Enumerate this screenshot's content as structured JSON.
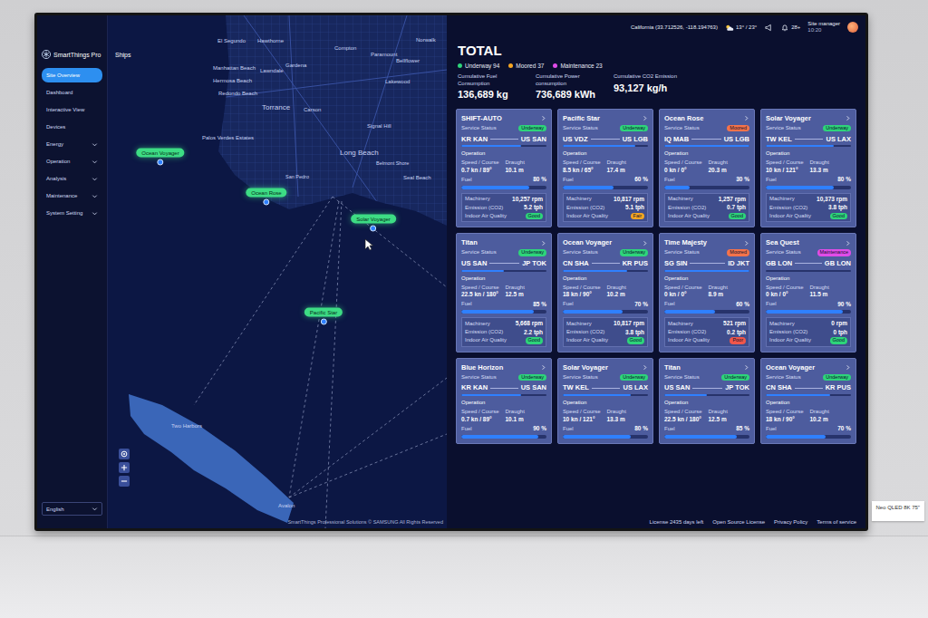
{
  "window": {
    "title": "SmartThings Pro"
  },
  "sidebar": {
    "logo": "SmartThings Pro",
    "items": [
      {
        "label": "Site Overview",
        "selected": true,
        "expandable": false
      },
      {
        "label": "Dashboard",
        "selected": false,
        "expandable": false
      },
      {
        "label": "Interactive View",
        "selected": false,
        "expandable": false
      },
      {
        "label": "Devices",
        "selected": false,
        "expandable": false
      },
      {
        "label": "Energy",
        "selected": false,
        "expandable": true
      },
      {
        "label": "Operation",
        "selected": false,
        "expandable": true
      },
      {
        "label": "Analysis",
        "selected": false,
        "expandable": true
      },
      {
        "label": "Maintenance",
        "selected": false,
        "expandable": true
      },
      {
        "label": "System Setting",
        "selected": false,
        "expandable": true
      }
    ],
    "language": "English"
  },
  "map": {
    "title": "Ships",
    "places": [
      {
        "label": "El Segundo"
      },
      {
        "label": "Hawthorne"
      },
      {
        "label": "Gardena"
      },
      {
        "label": "Compton"
      },
      {
        "label": "Paramount"
      },
      {
        "label": "Bellflower"
      },
      {
        "label": "Norwalk"
      },
      {
        "label": "Manhattan Beach"
      },
      {
        "label": "Lawndale"
      },
      {
        "label": "Hermosa Beach"
      },
      {
        "label": "Redondo Beach"
      },
      {
        "label": "Torrance"
      },
      {
        "label": "Carson"
      },
      {
        "label": "Lakewood"
      },
      {
        "label": "Signal Hill"
      },
      {
        "label": "Long Beach"
      },
      {
        "label": "Palos Verdes Estates"
      },
      {
        "label": "San Pedro"
      },
      {
        "label": "Belmont Shore"
      },
      {
        "label": "Seal Beach"
      },
      {
        "label": "Two Harbors"
      },
      {
        "label": "Avalon"
      }
    ],
    "ships": [
      {
        "label": "Ocean Voyager"
      },
      {
        "label": "Ocean Rose"
      },
      {
        "label": "Solar Voyager"
      },
      {
        "label": "Pacific Star"
      }
    ],
    "copyright": "SmartThings Professional Solutions © SAMSUNG All Rights Reserved"
  },
  "top_bar": {
    "location": "California (33.712526, -118.194763)",
    "weather": "13° / 23°",
    "notifications": "28+",
    "user": "Site manager",
    "time": "10:20"
  },
  "total": {
    "title": "TOTAL",
    "legend": [
      {
        "label": "Underway 94",
        "color": "#2ed47a"
      },
      {
        "label": "Moored 37",
        "color": "#f5a623"
      },
      {
        "label": "Maintenance 23",
        "color": "#e04ce8"
      }
    ],
    "stats": [
      {
        "label": "Cumulative Fuel Consumption",
        "value": "136,689 kg"
      },
      {
        "label": "Cumulative Power consumption",
        "value": "736,689 kWh"
      },
      {
        "label": "Cumulative CO2 Emission",
        "value": "93,127 kg/h"
      }
    ]
  },
  "card_labels": {
    "service_status": "Service Status",
    "operation": "Operation",
    "speed_course": "Speed / Course",
    "draught": "Draught",
    "fuel": "Fuel",
    "machinery": "Machinery",
    "emission": "Emission (CO2)",
    "air_quality": "Indoor Air Quality"
  },
  "cards": [
    {
      "name": "SHIFT-AUTO",
      "status": "Underway",
      "status_color": "#2ed47a",
      "from": "KR KAN",
      "to": "US SAN",
      "voyage_level": 0.7,
      "speed": "0.7 kn / 89°",
      "draught": "10.1 m",
      "fuel": "80 %",
      "fuel_level": 0.8,
      "machinery": "10,257 rpm",
      "emission": "5.2 tph",
      "air": "Good",
      "air_color": "#2ed47a"
    },
    {
      "name": "Pacific Star",
      "status": "Underway",
      "status_color": "#2ed47a",
      "from": "US VDZ",
      "to": "US LGB",
      "voyage_level": 0.85,
      "speed": "8.5 kn / 65°",
      "draught": "17.4 m",
      "fuel": "60 %",
      "fuel_level": 0.6,
      "machinery": "10,817 rpm",
      "emission": "5.1 tph",
      "air": "Fair",
      "air_color": "#f5a623"
    },
    {
      "name": "Ocean Rose",
      "status": "Moored",
      "status_color": "#f5734a",
      "from": "IQ MAB",
      "to": "US LGB",
      "voyage_level": 1,
      "speed": "0 kn / 0°",
      "draught": "20.3 m",
      "fuel": "30 %",
      "fuel_level": 0.3,
      "machinery": "1,257 rpm",
      "emission": "0.7 tph",
      "air": "Good",
      "air_color": "#2ed47a"
    },
    {
      "name": "Solar Voyager",
      "status": "Underway",
      "status_color": "#2ed47a",
      "from": "TW KEL",
      "to": "US LAX",
      "voyage_level": 0.8,
      "speed": "10 kn / 121°",
      "draught": "13.3 m",
      "fuel": "80 %",
      "fuel_level": 0.8,
      "machinery": "10,373 rpm",
      "emission": "3.8 tph",
      "air": "Good",
      "air_color": "#2ed47a"
    },
    {
      "name": "Titan",
      "status": "Underway",
      "status_color": "#2ed47a",
      "from": "US SAN",
      "to": "JP TOK",
      "voyage_level": 0.5,
      "speed": "22.5 kn / 180°",
      "draught": "12.5 m",
      "fuel": "85 %",
      "fuel_level": 0.85,
      "machinery": "5,668 rpm",
      "emission": "2.2 tph",
      "air": "Good",
      "air_color": "#2ed47a"
    },
    {
      "name": "Ocean Voyager",
      "status": "Underway",
      "status_color": "#2ed47a",
      "from": "CN SHA",
      "to": "KR PUS",
      "voyage_level": 0.75,
      "speed": "18 kn / 90°",
      "draught": "10.2 m",
      "fuel": "70 %",
      "fuel_level": 0.7,
      "machinery": "10,817 rpm",
      "emission": "3.8 tph",
      "air": "Good",
      "air_color": "#2ed47a"
    },
    {
      "name": "Time Majesty",
      "status": "Moored",
      "status_color": "#f5734a",
      "from": "SG SIN",
      "to": "ID JKT",
      "voyage_level": 1,
      "speed": "0 kn / 0°",
      "draught": "8.9 m",
      "fuel": "60 %",
      "fuel_level": 0.6,
      "machinery": "521 rpm",
      "emission": "0.2 tph",
      "air": "Poor",
      "air_color": "#f0564a"
    },
    {
      "name": "Sea Quest",
      "status": "Maintenance",
      "status_color": "#e04ce8",
      "from": "GB LON",
      "to": "GB LON",
      "voyage_level": 0,
      "speed": "0 kn / 0°",
      "draught": "11.5 m",
      "fuel": "90 %",
      "fuel_level": 0.9,
      "machinery": "0 rpm",
      "emission": "0 tph",
      "air": "Good",
      "air_color": "#2ed47a"
    },
    {
      "name": "Blue Horizon",
      "status": "Underway",
      "status_color": "#2ed47a",
      "from": "KR KAN",
      "to": "US SAN",
      "voyage_level": 0.7,
      "speed": "0.7 kn / 89°",
      "draught": "10.1 m",
      "fuel": "90 %",
      "fuel_level": 0.9
    },
    {
      "name": "Solar Voyager",
      "status": "Underway",
      "status_color": "#2ed47a",
      "from": "TW KEL",
      "to": "US LAX",
      "voyage_level": 0.8,
      "speed": "10 kn / 121°",
      "draught": "13.3 m",
      "fuel": "80 %",
      "fuel_level": 0.8
    },
    {
      "name": "Titan",
      "status": "Underway",
      "status_color": "#2ed47a",
      "from": "US SAN",
      "to": "JP TOK",
      "voyage_level": 0.5,
      "speed": "22.5 kn / 180°",
      "draught": "12.5 m",
      "fuel": "85 %",
      "fuel_level": 0.85
    },
    {
      "name": "Ocean Voyager",
      "status": "Underway",
      "status_color": "#2ed47a",
      "from": "CN SHA",
      "to": "KR PUS",
      "voyage_level": 0.75,
      "speed": "18 kn / 90°",
      "draught": "10.2 m",
      "fuel": "70 %",
      "fuel_level": 0.7
    }
  ],
  "footer": {
    "license": "License 2435 days left",
    "links": [
      "Open Source License",
      "Privacy Policy",
      "Terms of service"
    ]
  },
  "product_label": "Neo QLED 8K 75\""
}
